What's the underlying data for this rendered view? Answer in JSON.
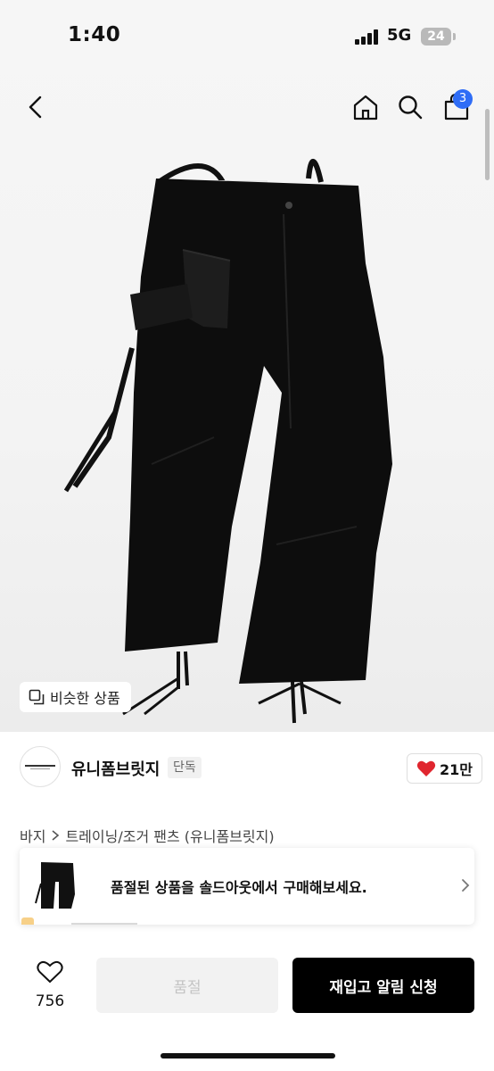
{
  "status_bar": {
    "time": "1:40",
    "network": "5G",
    "battery": "24"
  },
  "nav": {
    "cart_count": "3"
  },
  "hero": {
    "similar_label": "비슷한 상품"
  },
  "brand": {
    "name": "유니폼브릿지",
    "tag": "단독",
    "likes": "21만"
  },
  "breadcrumb": {
    "category": "바지",
    "subcategory": "트레이닝/조거 팬츠 (유니폼브릿지)"
  },
  "soldout_banner": {
    "text": "품절된 상품을 솔드아웃에서 구매해보세요."
  },
  "bottom_bar": {
    "wish_count": "756",
    "soldout_label": "품절",
    "restock_label": "재입고 알림 신청"
  },
  "colors": {
    "accent_badge": "#2f6df6",
    "like_heart": "#e0262f",
    "primary_button": "#000000"
  },
  "icons": [
    "back-arrow-icon",
    "home-icon",
    "search-icon",
    "cart-icon",
    "copy-icon",
    "heart-icon",
    "chevron-right-icon"
  ]
}
